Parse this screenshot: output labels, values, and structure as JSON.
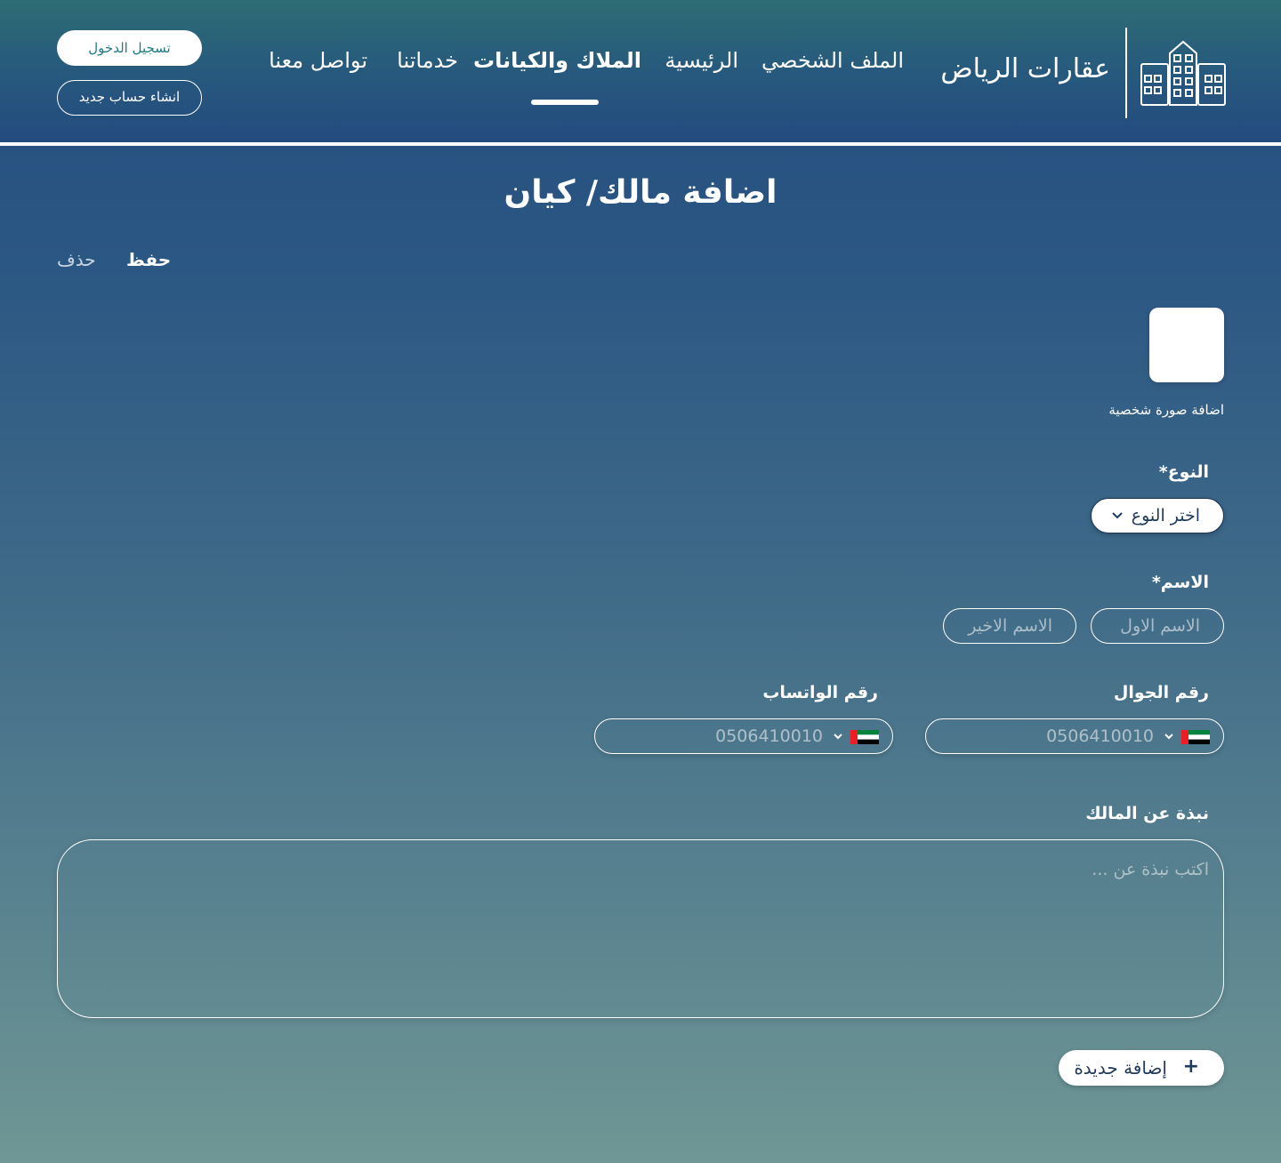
{
  "header": {
    "brand": "عقارات الرياض",
    "nav": {
      "profile": "الملف الشخصي",
      "home": "الرئيسية",
      "properties": "الملاك والكيانات",
      "services": "خدماتنا",
      "contact": "تواصل معنا"
    },
    "login_label": "تسجيل الدخول",
    "register_label": "انشاء حساب جديد"
  },
  "page": {
    "title": "اضافة مالك/ كيان",
    "save_label": "حفظ",
    "delete_label": "حذف",
    "avatar_label": "اضافة صورة شخصية"
  },
  "form": {
    "type_label": "النوع*",
    "type_value": "اختر النوع",
    "name_label": "الاسم*",
    "first_name_placeholder": "الاسم الاول",
    "last_name_placeholder": "الاسم الاخير",
    "mobile_label": "رقم الجوال",
    "mobile_value": "0506410010",
    "whatsapp_label": "رقم الواتساب",
    "whatsapp_value": "0506410010",
    "bio_label": "نبذة عن المالك",
    "bio_placeholder": "اكتب نبذة عن ...",
    "add_new_label": "إضافة جديدة",
    "add_icon": "+"
  },
  "icons": {
    "logo": "buildings-icon",
    "chevron": "chevron-down-icon",
    "flag": "uae-flag-icon"
  },
  "colors": {
    "header_top": "#2d6c73",
    "header_bottom": "#234b7f",
    "page_bottom": "#6f9795",
    "login_text": "#1f7a87",
    "dark_text": "#1f3a5a"
  }
}
